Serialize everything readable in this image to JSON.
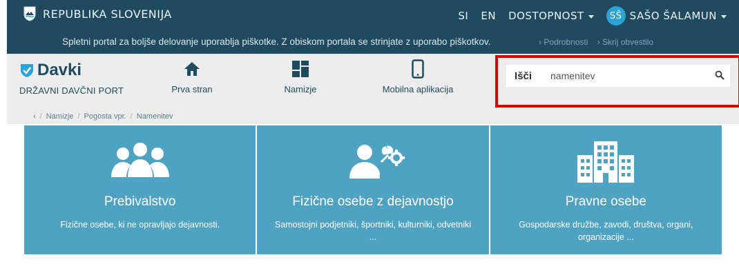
{
  "topbar": {
    "brand": "REPUBLIKA SLOVENIJA",
    "lang_si": "SI",
    "lang_en": "EN",
    "accessibility": "DOSTOPNOST",
    "avatar_initials": "SŠ",
    "user_name": "SAŠO ŠALAMUN",
    "bg_color": "#1f4a60"
  },
  "cookie": {
    "message": "Spletni portal za boljše delovanje uporablja piškotke. Z obiskom portala se strinjate z uporabo piškotkov.",
    "details_link": "› Podrobnosti",
    "hide_link": "› Skrij obvestilo"
  },
  "header": {
    "logo_title": "Davki",
    "logo_subtitle": "DRŽAVNI DAVČNI PORT",
    "nav": [
      {
        "label": "Prva stran",
        "icon": "home-icon"
      },
      {
        "label": "Namizje",
        "icon": "dashboard-icon"
      },
      {
        "label": "Mobilna aplikacija",
        "icon": "mobile-icon"
      }
    ]
  },
  "search": {
    "label": "Išči",
    "value": "namenitev",
    "highlight_color": "#e00000"
  },
  "breadcrumb": {
    "back": "‹",
    "items": [
      "Namizje",
      "Pogosta vpr.",
      "Namenitev"
    ]
  },
  "tiles": [
    {
      "title": "Prebivalstvo",
      "desc": "Fizične osebe, ki ne opravljajo dejavnosti.",
      "icon": "people-icon"
    },
    {
      "title": "Fizične osebe z dejavnostjo",
      "desc": "Samostojni podjetniki, športniki, kulturniki, odvetniki ...",
      "icon": "person-tools-icon"
    },
    {
      "title": "Pravne osebe",
      "desc": "Gospodarske družbe, zavodi, društva, organi, organizacije ...",
      "icon": "building-icon"
    }
  ],
  "tile_color": "#4ea3c3"
}
